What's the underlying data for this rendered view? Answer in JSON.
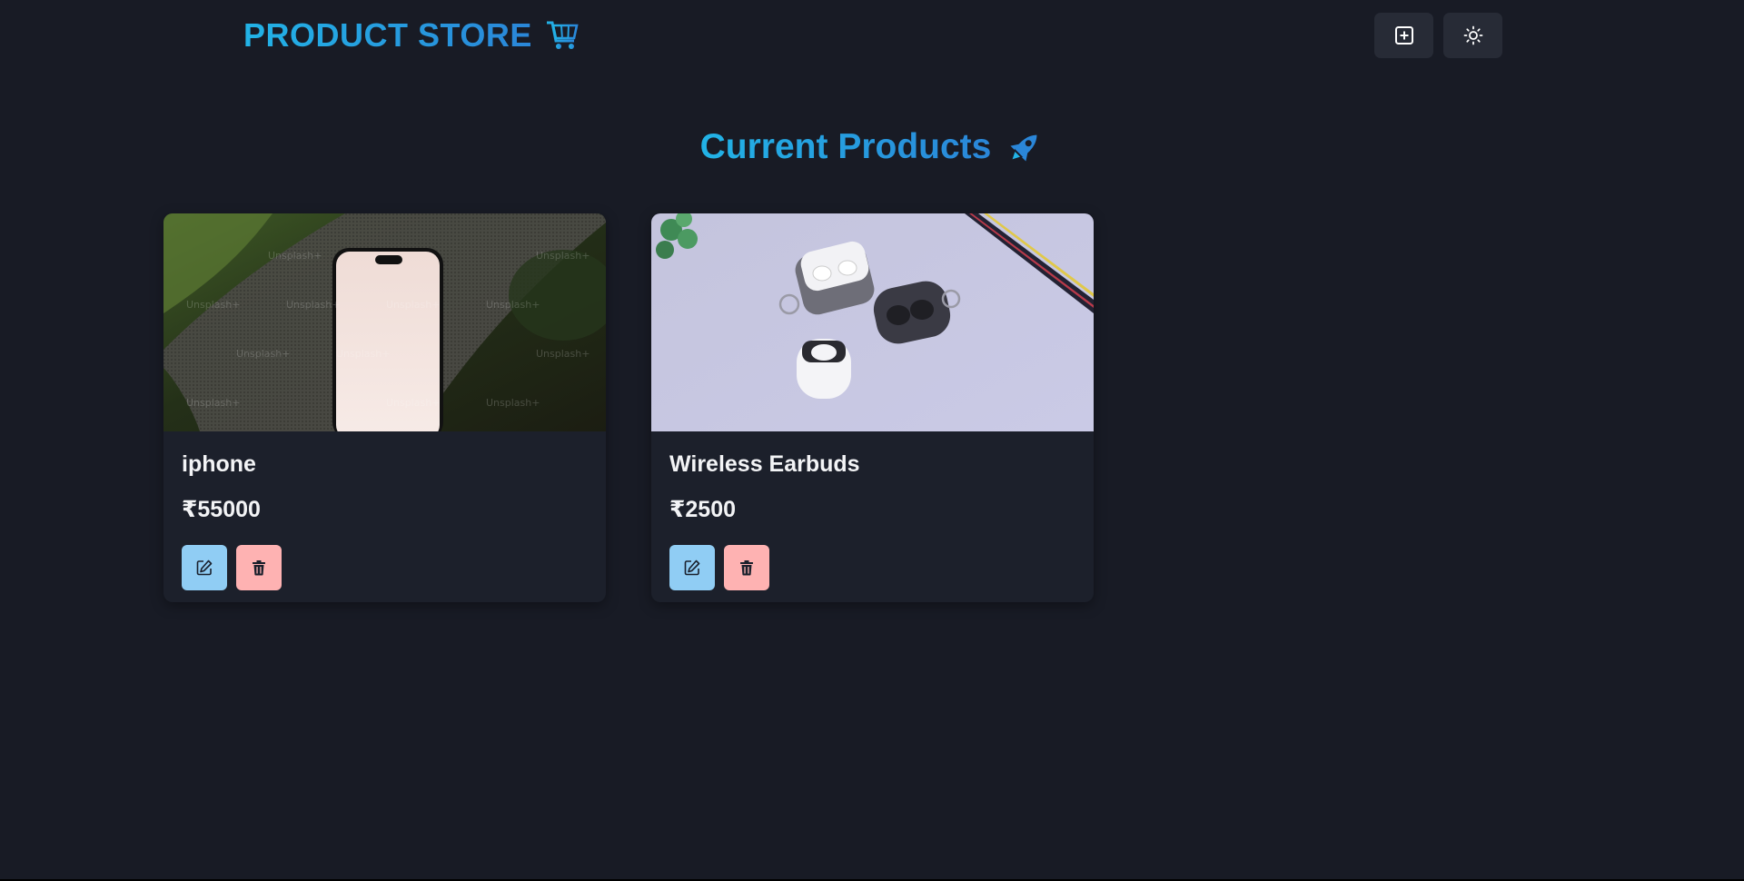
{
  "navbar": {
    "brand_title": "PRODUCT STORE",
    "brand_icon": "shopping-cart-icon",
    "create_button_icon": "plus-square-icon",
    "theme_toggle_icon": "sun-icon"
  },
  "main": {
    "heading": "Current Products",
    "heading_icon": "rocket-icon"
  },
  "products": [
    {
      "name": "iphone",
      "price": "₹55000",
      "image": "phone-photo"
    },
    {
      "name": "Wireless Earbuds",
      "price": "₹2500",
      "image": "earbuds-photo"
    }
  ],
  "colors": {
    "background": "#181b25",
    "accent": "#1fa6e0",
    "card": "#1c202b",
    "edit_button": "#90cdf4",
    "delete_button": "#feb2b2"
  }
}
